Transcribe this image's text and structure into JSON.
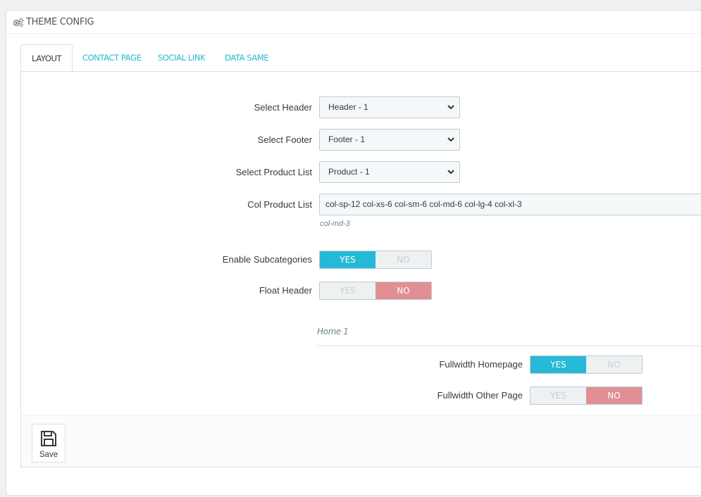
{
  "panel": {
    "title": "THEME CONFIG",
    "icon": "cogs-icon"
  },
  "tabs": [
    {
      "label": "LAYOUT",
      "active": true
    },
    {
      "label": "CONTACT PAGE",
      "active": false
    },
    {
      "label": "SOCIAL LINK",
      "active": false
    },
    {
      "label": "DATA SAME",
      "active": false
    }
  ],
  "form": {
    "select_header": {
      "label": "Select Header",
      "value": "Header - 1"
    },
    "select_footer": {
      "label": "Select Footer",
      "value": "Footer - 1"
    },
    "select_product_list": {
      "label": "Select Product List",
      "value": "Product - 1"
    },
    "col_product_list": {
      "label": "Col Product List",
      "value": "col-sp-12 col-xs-6 col-sm-6 col-md-6 col-lg-4 col-xl-3",
      "help": "col-md-3"
    },
    "enable_subcategories": {
      "label": "Enable Subcategories",
      "yes": "YES",
      "no": "NO",
      "value": "YES"
    },
    "float_header": {
      "label": "Float Header",
      "yes": "YES",
      "no": "NO",
      "value": "NO"
    }
  },
  "home_section": {
    "title": "Home 1",
    "fullwidth_homepage": {
      "label": "Fullwidth Homepage",
      "yes": "YES",
      "no": "NO",
      "value": "YES"
    },
    "fullwidth_other_page": {
      "label": "Fullwidth Other Page",
      "yes": "YES",
      "no": "NO",
      "value": "NO"
    }
  },
  "footer": {
    "save_label": "Save",
    "save_icon": "floppy-disk-icon"
  },
  "colors": {
    "accent": "#25b9d7",
    "no_active": "#e08f95"
  }
}
